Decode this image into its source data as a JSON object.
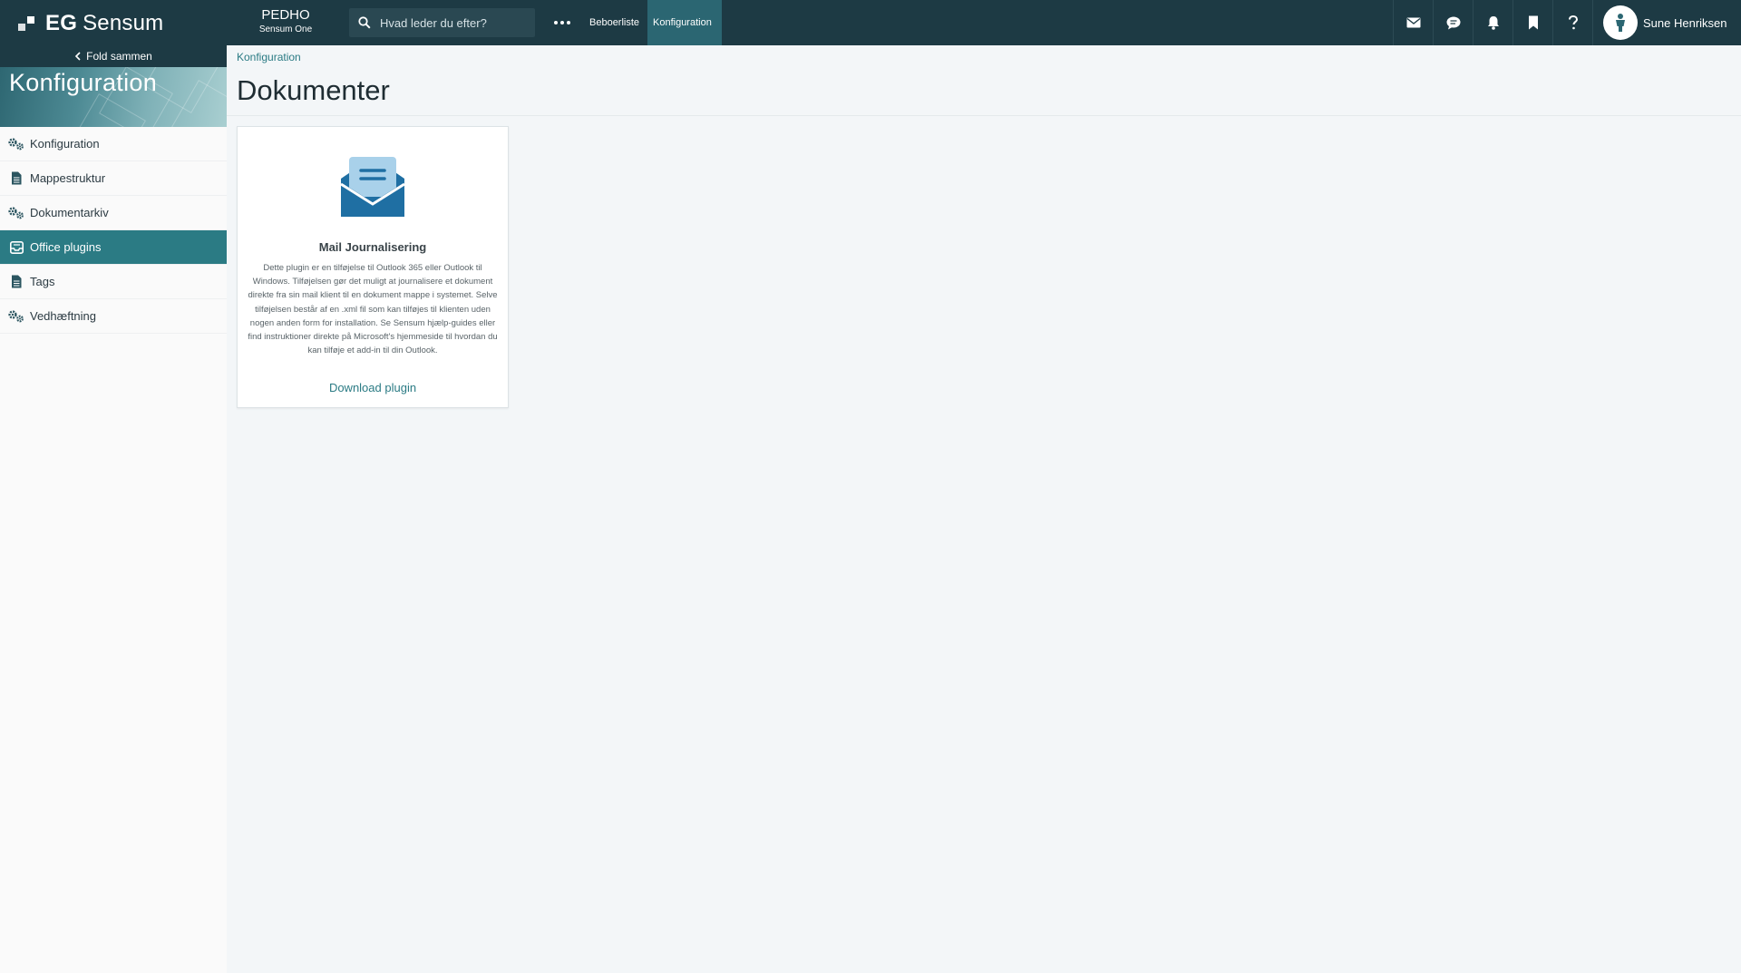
{
  "header": {
    "logo_brand": "EG",
    "logo_product": "Sensum",
    "tenant_name": "PEDHO",
    "tenant_sub": "Sensum One",
    "search_placeholder": "Hvad leder du efter?",
    "more_icon": "more-horizontal-icon",
    "nav": [
      {
        "label": "Beboerliste",
        "active": false
      },
      {
        "label": "Konfiguration",
        "active": true
      }
    ],
    "icons": [
      "mail-icon",
      "chat-icon",
      "bell-icon",
      "bookmark-icon",
      "help-icon"
    ],
    "user_name": "Sune Henriksen",
    "colors": {
      "topbar": "#1d3a44",
      "active_nav": "#2b6672",
      "accent": "#2b7b84"
    }
  },
  "sidebar": {
    "collapse_label": "Fold sammen",
    "banner_title": "Konfiguration",
    "items": [
      {
        "label": "Konfiguration",
        "icon": "gears-icon",
        "active": false
      },
      {
        "label": "Mappestruktur",
        "icon": "document-icon",
        "active": false
      },
      {
        "label": "Dokumentarkiv",
        "icon": "gears-icon",
        "active": false
      },
      {
        "label": "Office plugins",
        "icon": "inbox-icon",
        "active": true
      },
      {
        "label": "Tags",
        "icon": "document-icon",
        "active": false
      },
      {
        "label": "Vedhæftning",
        "icon": "gears-icon",
        "active": false
      }
    ]
  },
  "main": {
    "breadcrumb": "Konfiguration",
    "title": "Dokumenter",
    "card": {
      "icon": "open-envelope-icon",
      "title": "Mail Journalisering",
      "description": "Dette plugin er en tilføjelse til Outlook 365 eller Outlook til Windows. Tilføjelsen gør det muligt at journalisere et dokument direkte fra sin mail klient til en dokument mappe i systemet. Selve tilføjelsen består af en .xml fil som kan tilføjes til klienten uden nogen anden form for installation. Se Sensum hjælp-guides eller find instruktioner direkte på Microsoft's hjemmeside til hvordan du kan tilføje et add-in til din Outlook.",
      "link_label": "Download plugin"
    }
  }
}
